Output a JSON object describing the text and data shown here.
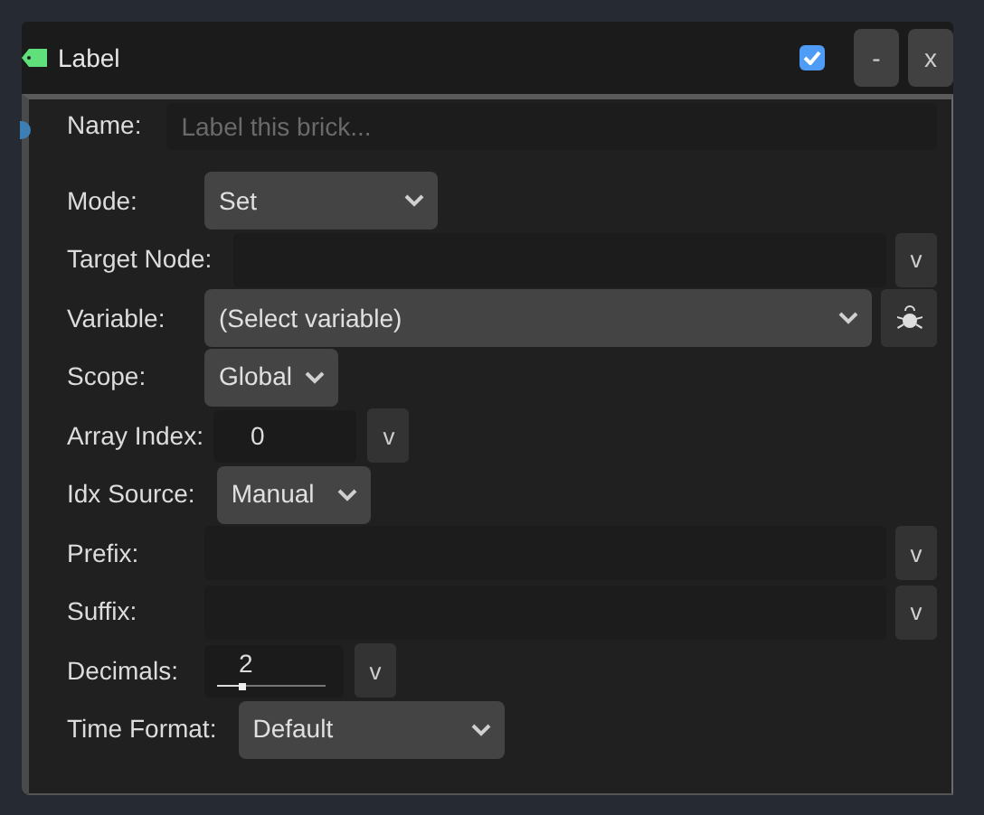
{
  "header": {
    "title": "Label",
    "enabled": true,
    "buttons": [
      "-",
      "x"
    ]
  },
  "name": {
    "label": "Name:",
    "placeholder": "Label this brick..."
  },
  "rows": [
    {
      "kind": "select",
      "label": "Mode:",
      "value": "Set"
    },
    {
      "kind": "text",
      "label": "Target Node:",
      "button": "v"
    },
    {
      "kind": "select-bug",
      "label": "Variable:",
      "value": "(Select variable)"
    },
    {
      "kind": "select",
      "label": "Scope:",
      "value": "Global"
    },
    {
      "kind": "number",
      "label": "Array Index:",
      "value": "0",
      "button": "v"
    },
    {
      "kind": "select",
      "label": "Idx Source:",
      "value": "Manual"
    },
    {
      "kind": "text",
      "label": "Prefix:",
      "button": "v"
    },
    {
      "kind": "text",
      "label": "Suffix:",
      "button": "v"
    },
    {
      "kind": "slider",
      "label": "Decimals:",
      "value": "2",
      "level": 0.23,
      "button": "v"
    },
    {
      "kind": "select",
      "label": "Time Format:",
      "value": "Default"
    }
  ]
}
